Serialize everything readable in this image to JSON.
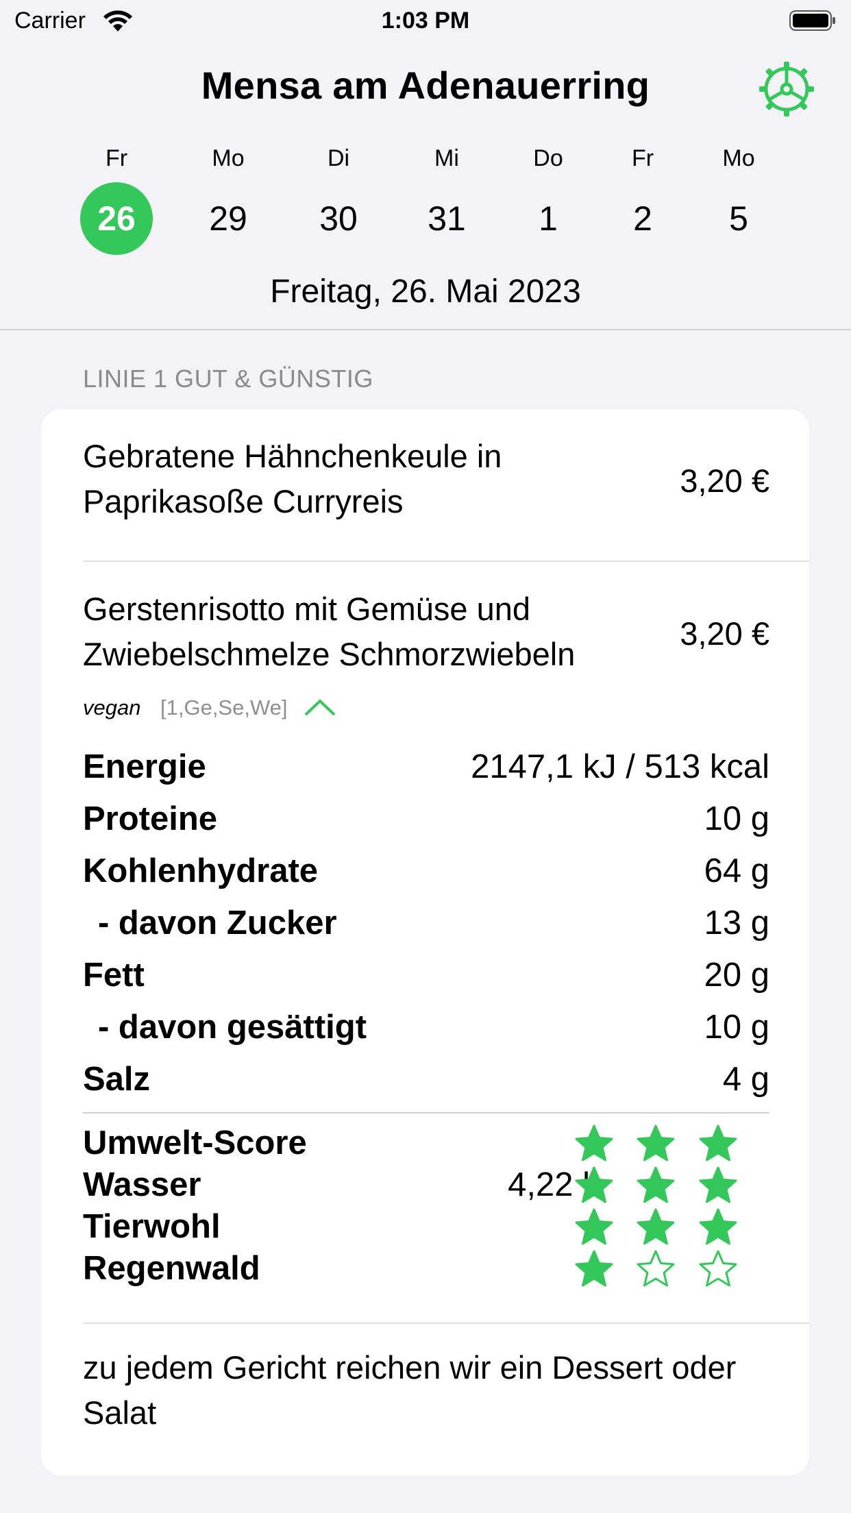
{
  "status_bar": {
    "carrier": "Carrier",
    "time": "1:03 PM"
  },
  "header": {
    "title": "Mensa am Adenauerring",
    "settings_icon": "gear-icon",
    "accent_color": "#34c759",
    "days": [
      {
        "weekday": "Fr",
        "day": "26",
        "selected": true
      },
      {
        "weekday": "Mo",
        "day": "29"
      },
      {
        "weekday": "Di",
        "day": "30"
      },
      {
        "weekday": "Mi",
        "day": "31"
      },
      {
        "weekday": "Do",
        "day": "1"
      },
      {
        "weekday": "Fr",
        "day": "2"
      },
      {
        "weekday": "Mo",
        "day": "5"
      }
    ],
    "date_label": "Freitag, 26. Mai 2023"
  },
  "section": {
    "title": "LINIE 1 GUT & GÜNSTIG",
    "meals": [
      {
        "name": "Gebratene Hähnchenkeule in Paprikasoße Curryreis",
        "price": "3,20 €"
      },
      {
        "name": "Gerstenrisotto mit Gemüse und Zwiebelschmelze Schmorzwiebeln",
        "price": "3,20 €",
        "tag": "vegan",
        "allergens": "[1,Ge,Se,We]",
        "expanded": true,
        "nutrition": [
          {
            "label": "Energie",
            "value": "2147,1 kJ / 513 kcal"
          },
          {
            "label": "Proteine",
            "value": "10 g"
          },
          {
            "label": "Kohlenhydrate",
            "value": "64 g"
          },
          {
            "label": "- davon Zucker",
            "value": "13 g"
          },
          {
            "label": "Fett",
            "value": "20 g"
          },
          {
            "label": "- davon gesättigt",
            "value": "10 g"
          },
          {
            "label": "Salz",
            "value": "4 g"
          }
        ],
        "scores": [
          {
            "label": "Umwelt-Score",
            "value": "",
            "rating": 3,
            "max": 3
          },
          {
            "label": "Wasser",
            "value": "4,22 l",
            "rating": 3,
            "max": 3
          },
          {
            "label": "Tierwohl",
            "value": "",
            "rating": 3,
            "max": 3
          },
          {
            "label": "Regenwald",
            "value": "",
            "rating": 1,
            "max": 3
          }
        ]
      }
    ],
    "footer_note": "zu jedem Gericht reichen wir ein Dessert oder Salat"
  }
}
